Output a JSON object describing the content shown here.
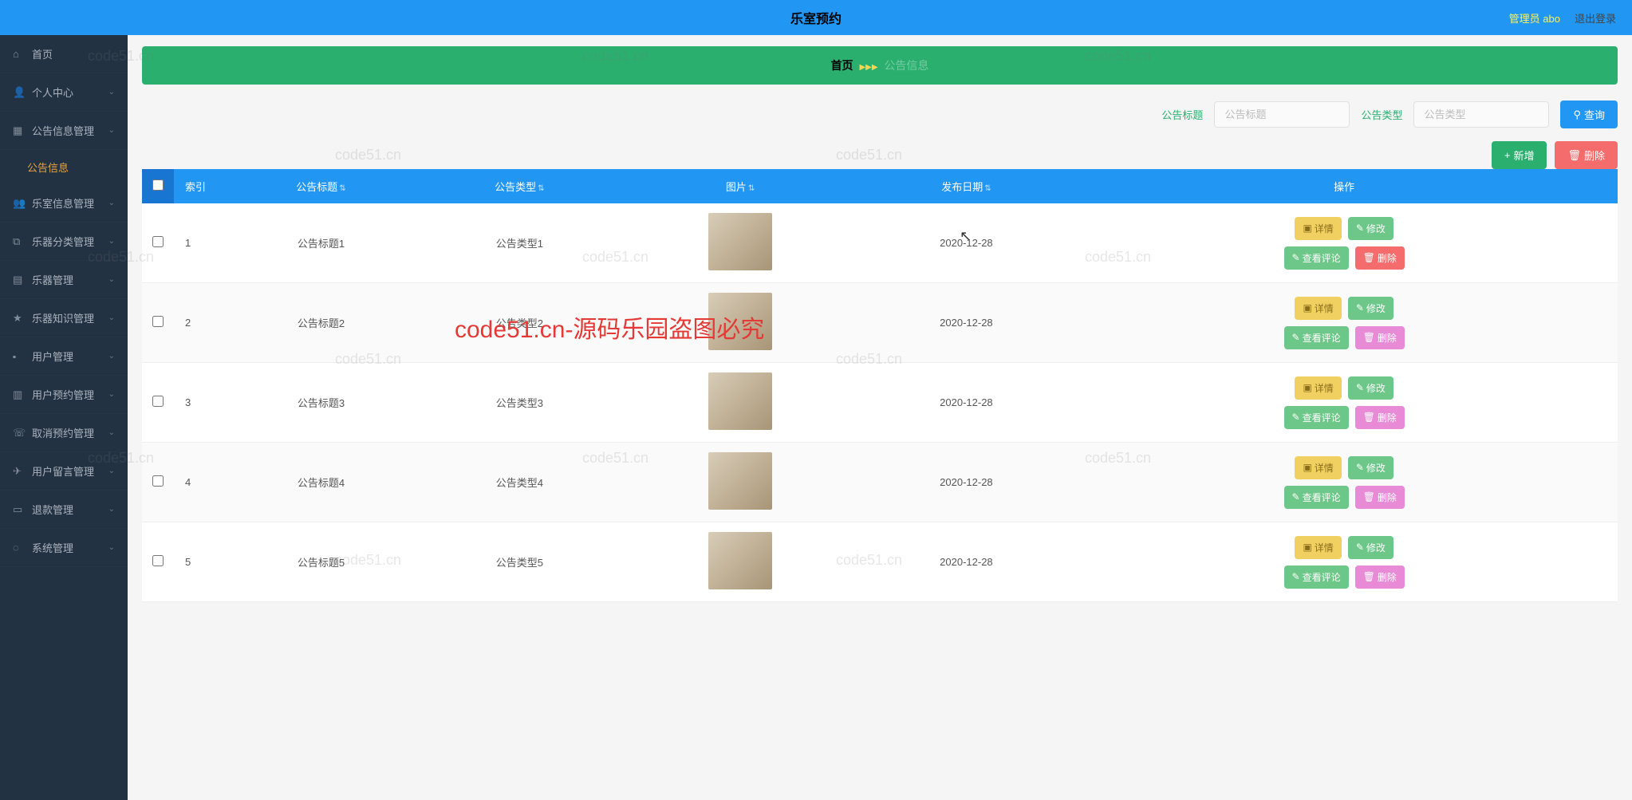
{
  "header": {
    "title": "乐室预约",
    "user": "管理员 abo",
    "logout": "退出登录"
  },
  "sidebar": {
    "items": [
      {
        "label": "首页",
        "icon": "home",
        "expandable": false
      },
      {
        "label": "个人中心",
        "icon": "user",
        "expandable": true
      },
      {
        "label": "公告信息管理",
        "icon": "grid",
        "expandable": true,
        "open": true,
        "sub": "公告信息"
      },
      {
        "label": "乐室信息管理",
        "icon": "group",
        "expandable": true
      },
      {
        "label": "乐器分类管理",
        "icon": "copy",
        "expandable": true
      },
      {
        "label": "乐器管理",
        "icon": "doc",
        "expandable": true
      },
      {
        "label": "乐器知识管理",
        "icon": "star",
        "expandable": true
      },
      {
        "label": "用户管理",
        "icon": "case",
        "expandable": true
      },
      {
        "label": "用户预约管理",
        "icon": "form",
        "expandable": true
      },
      {
        "label": "取消预约管理",
        "icon": "phone",
        "expandable": true
      },
      {
        "label": "用户留言管理",
        "icon": "plane",
        "expandable": true
      },
      {
        "label": "退款管理",
        "icon": "card",
        "expandable": true
      },
      {
        "label": "系统管理",
        "icon": "cog",
        "expandable": true
      }
    ]
  },
  "breadcrumb": {
    "home": "首页",
    "current": "公告信息"
  },
  "search": {
    "label_title": "公告标题",
    "placeholder_title": "公告标题",
    "label_type": "公告类型",
    "placeholder_type": "公告类型",
    "query_btn": "查询"
  },
  "toolbar": {
    "add": "新增",
    "delete": "删除"
  },
  "table": {
    "headers": {
      "index": "索引",
      "title": "公告标题",
      "type": "公告类型",
      "image": "图片",
      "date": "发布日期",
      "action": "操作"
    },
    "actions": {
      "detail": "详情",
      "edit": "修改",
      "view": "查看评论",
      "delete": "删除"
    },
    "rows": [
      {
        "idx": "1",
        "title": "公告标题1",
        "type": "公告类型1",
        "date": "2020-12-28",
        "del_style": "red"
      },
      {
        "idx": "2",
        "title": "公告标题2",
        "type": "公告类型2",
        "date": "2020-12-28",
        "del_style": "pink"
      },
      {
        "idx": "3",
        "title": "公告标题3",
        "type": "公告类型3",
        "date": "2020-12-28",
        "del_style": "pink"
      },
      {
        "idx": "4",
        "title": "公告标题4",
        "type": "公告类型4",
        "date": "2020-12-28",
        "del_style": "pink"
      },
      {
        "idx": "5",
        "title": "公告标题5",
        "type": "公告类型5",
        "date": "2020-12-28",
        "del_style": "pink"
      }
    ]
  },
  "overlay_text": "code51.cn-源码乐园盗图必究",
  "watermark": "code51.cn"
}
